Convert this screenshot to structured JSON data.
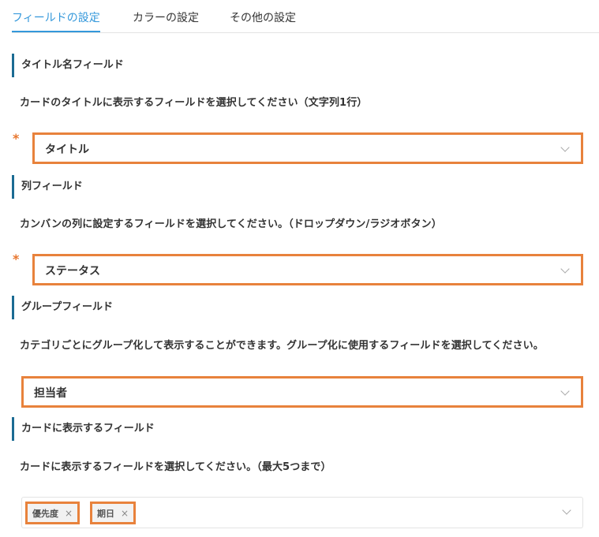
{
  "tabs": [
    {
      "label": "フィールドの設定"
    },
    {
      "label": "カラーの設定"
    },
    {
      "label": "その他の設定"
    }
  ],
  "required_mark": "*",
  "title_field": {
    "title": "タイトル名フィールド",
    "description": "カードのタイトルに表示するフィールドを選択してください（文字列1行）",
    "value": "タイトル"
  },
  "column_field": {
    "title": "列フィールド",
    "description": "カンバンの列に設定するフィールドを選択してください。（ドロップダウン/ラジオボタン）",
    "value": "ステータス"
  },
  "group_field": {
    "title": "グループフィールド",
    "description": "カテゴリごとにグループ化して表示することができます。グループ化に使用するフィールドを選択してください。",
    "value": "担当者"
  },
  "card_fields": {
    "title": "カードに表示するフィールド",
    "description": "カードに表示するフィールドを選択してください。（最大5つまで）",
    "tags": [
      {
        "label": "優先度",
        "close": "×"
      },
      {
        "label": "期日",
        "close": "×"
      }
    ]
  },
  "colors": {
    "accent": "#3498db",
    "section_bar": "#1b6b93",
    "highlight": "#e8823c",
    "required": "#e8762d"
  }
}
